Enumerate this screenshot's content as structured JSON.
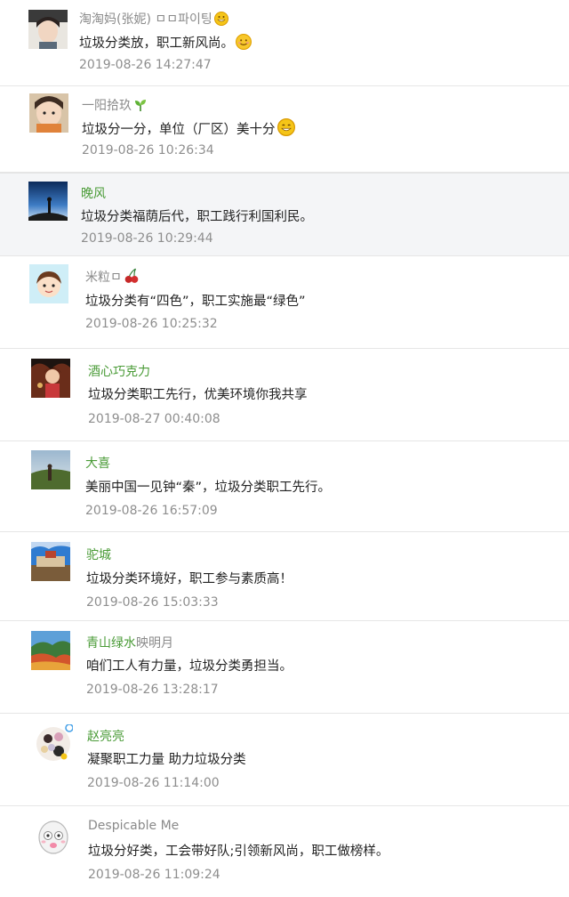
{
  "comments": [
    {
      "nickname": "淘淘妈(张妮) ㅁㅁ파이팅",
      "nick_emoji": "grinning-face-emoji",
      "text": "垃圾分类放，职工新风尚。",
      "text_emoji": "smiling-face-emoji",
      "time": "2019-08-26 14:27:47"
    },
    {
      "nickname": "一阳拾玖",
      "nick_emoji": "seedling-emoji",
      "text": "垃圾分一分，单位（厂区）美十分",
      "text_emoji": "grinning-face-emoji",
      "time": "2019-08-26 10:26:34"
    },
    {
      "nickname": "晚风",
      "text": "垃圾分类福荫后代，职工践行利国利民。",
      "time": "2019-08-26 10:29:44"
    },
    {
      "nickname": "米粒ㅁ",
      "nick_emoji": "cherries-emoji",
      "text": "垃圾分类有“四色”，职工实施最“绿色”",
      "time": "2019-08-26 10:25:32"
    },
    {
      "nickname": "酒心巧克力",
      "text": "垃圾分类职工先行，优美环境你我共享",
      "time": "2019-08-27 00:40:08"
    },
    {
      "nickname": "大喜",
      "text": "美丽中国一见钟“秦”，垃圾分类职工先行。",
      "time": "2019-08-26 16:57:09"
    },
    {
      "nickname": "驼城",
      "text": "垃圾分类环境好，职工参与素质高！",
      "time": "2019-08-26 15:03:33"
    },
    {
      "nickname": "青山绿水",
      "nickname_suffix": "映明月",
      "text": "咱们工人有力量，垃圾分类勇担当。",
      "time": "2019-08-26 13:28:17"
    },
    {
      "nickname": "赵亮亮",
      "text": "凝聚职工力量 助力垃圾分类",
      "time": "2019-08-26 11:14:00"
    },
    {
      "nickname": "Despicable Me",
      "text": "垃圾分好类，工会带好队;引领新风尚，职工做榜样。",
      "time": "2019-08-26 11:09:24"
    }
  ]
}
